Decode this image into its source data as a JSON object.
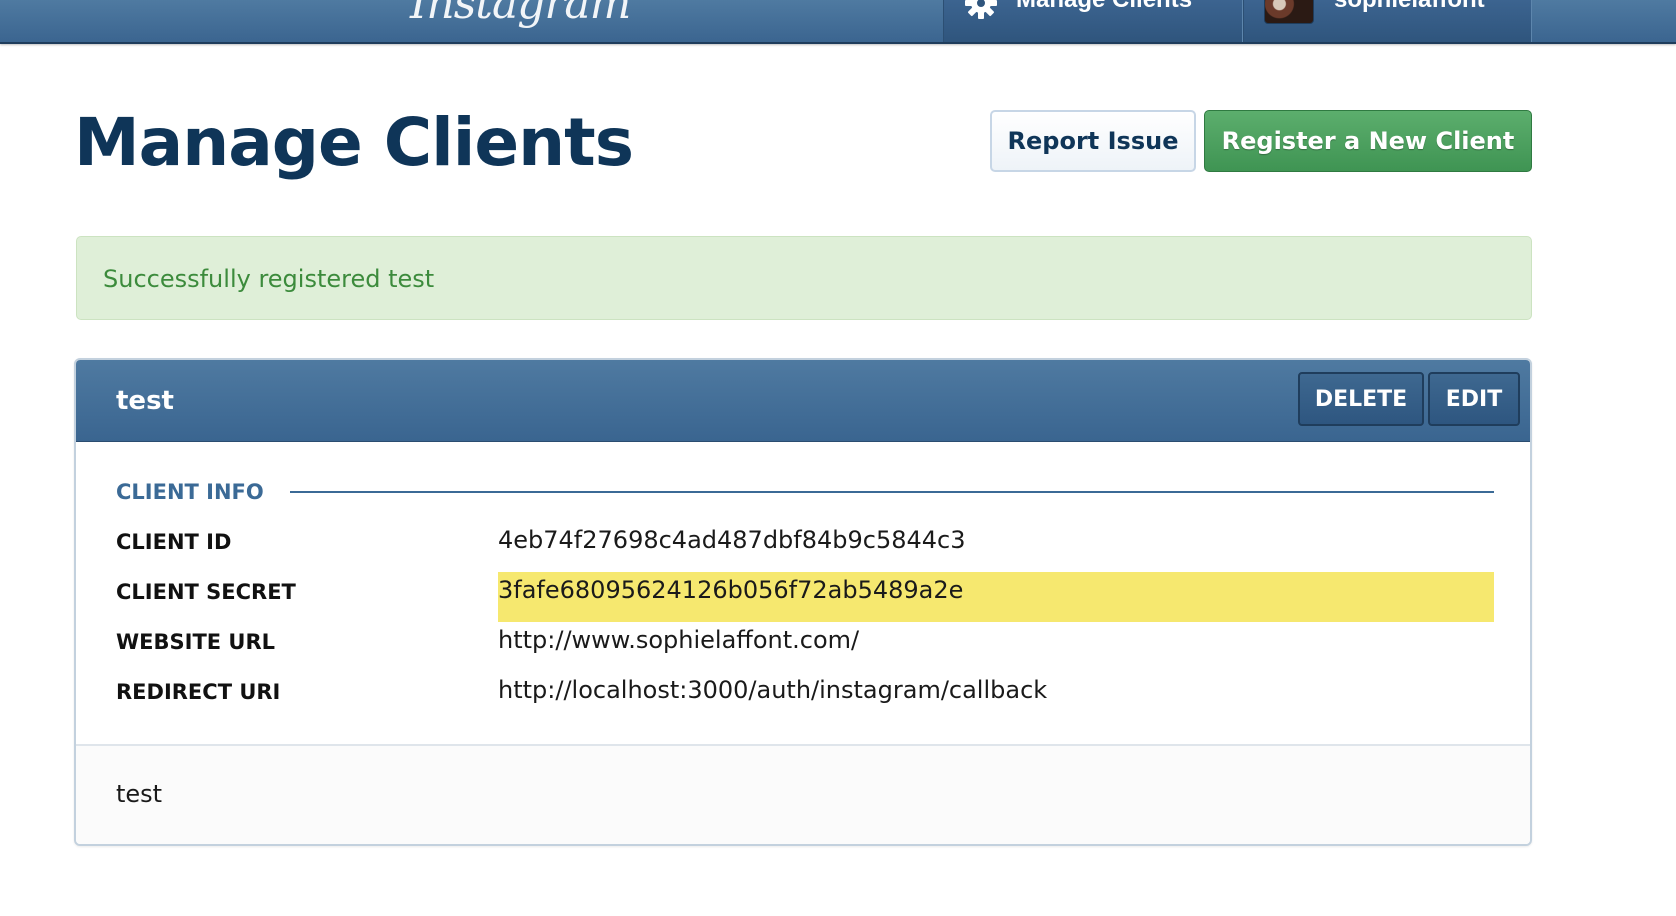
{
  "topbar": {
    "logo_text": "Instagram",
    "nav": {
      "manage_clients_label": "Manage Clients",
      "manage_clients_icon": "gear-icon",
      "username": "sophielaffont"
    }
  },
  "header": {
    "title": "Manage Clients",
    "report_issue_label": "Report Issue",
    "register_label": "Register a New Client"
  },
  "alert": {
    "message": "Successfully registered test",
    "color": "#3c8b3c",
    "background": "#dfefd8"
  },
  "client": {
    "name": "test",
    "delete_label": "DELETE",
    "edit_label": "EDIT",
    "section_title": "CLIENT INFO",
    "fields": [
      {
        "label": "CLIENT ID",
        "value": "4eb74f27698c4ad487dbf84b9c5844c3"
      },
      {
        "label": "CLIENT SECRET",
        "value": "3fafe68095624126b056f72ab5489a2e"
      },
      {
        "label": "WEBSITE URL",
        "value": "http://www.sophielaffont.com/"
      },
      {
        "label": "REDIRECT URI",
        "value": "http://localhost:3000/auth/instagram/callback"
      }
    ],
    "description": "test"
  },
  "colors": {
    "brand_blue": "#3b6590",
    "title_navy": "#0f3558",
    "register_green": "#4ea160",
    "highlight_yellow": "#f6e86f"
  }
}
